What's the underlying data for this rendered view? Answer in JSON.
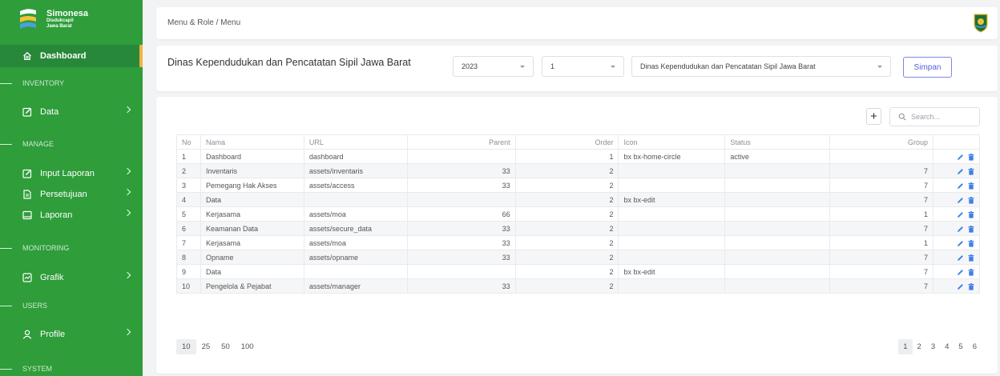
{
  "brand": {
    "title": "Simonesa",
    "subtitle1": "Disdukcapil",
    "subtitle2": "Jawa Barat"
  },
  "sidebar": {
    "items": [
      {
        "label": "Dashboard",
        "icon": "home-icon",
        "active": true
      },
      {
        "section": "INVENTORY"
      },
      {
        "label": "Data",
        "icon": "edit-icon"
      },
      {
        "section": "MANAGE"
      },
      {
        "label": "Input Laporan",
        "icon": "edit-icon"
      },
      {
        "label": "Persetujuan",
        "icon": "document-icon"
      },
      {
        "label": "Laporan",
        "icon": "card-icon"
      },
      {
        "section": "MONITORING"
      },
      {
        "label": "Grafik",
        "icon": "chart-icon"
      },
      {
        "section": "USERS"
      },
      {
        "label": "Profile",
        "icon": "user-icon"
      },
      {
        "section": "SYSTEM"
      }
    ]
  },
  "header": {
    "breadcrumb": "Menu & Role / Menu"
  },
  "filter": {
    "org_title": "Dinas Kependudukan dan Pencatatan Sipil Jawa Barat",
    "year": "2023",
    "period": "1",
    "org_select": "Dinas Kependudukan dan Pencatatan Sipil Jawa Barat",
    "save_label": "Simpan"
  },
  "table": {
    "add_label": "+",
    "search_placeholder": "Search...",
    "columns": [
      "No",
      "Nama",
      "URL",
      "Parent",
      "Order",
      "Icon",
      "Status",
      "Group"
    ],
    "rows": [
      {
        "no": "1",
        "nama": "Dashboard",
        "url": "dashboard",
        "parent": "",
        "order": "1",
        "icon": "bx bx-home-circle",
        "status": "active",
        "group": ""
      },
      {
        "no": "2",
        "nama": "Inventaris",
        "url": "assets/inventaris",
        "parent": "33",
        "order": "2",
        "icon": "",
        "status": "",
        "group": "7"
      },
      {
        "no": "3",
        "nama": "Pemegang Hak Akses",
        "url": "assets/access",
        "parent": "33",
        "order": "2",
        "icon": "",
        "status": "",
        "group": "7"
      },
      {
        "no": "4",
        "nama": "Data",
        "url": "",
        "parent": "",
        "order": "2",
        "icon": "bx bx-edit",
        "status": "",
        "group": "7"
      },
      {
        "no": "5",
        "nama": "Kerjasama",
        "url": "assets/moa",
        "parent": "66",
        "order": "2",
        "icon": "",
        "status": "",
        "group": "1"
      },
      {
        "no": "6",
        "nama": "Keamanan Data",
        "url": "assets/secure_data",
        "parent": "33",
        "order": "2",
        "icon": "",
        "status": "",
        "group": "7"
      },
      {
        "no": "7",
        "nama": "Kerjasama",
        "url": "assets/moa",
        "parent": "33",
        "order": "2",
        "icon": "",
        "status": "",
        "group": "1"
      },
      {
        "no": "8",
        "nama": "Opname",
        "url": "assets/opname",
        "parent": "33",
        "order": "2",
        "icon": "",
        "status": "",
        "group": "7"
      },
      {
        "no": "9",
        "nama": "Data",
        "url": "",
        "parent": "",
        "order": "2",
        "icon": "bx bx-edit",
        "status": "",
        "group": "7"
      },
      {
        "no": "10",
        "nama": "Pengelola & Pejabat",
        "url": "assets/manager",
        "parent": "33",
        "order": "2",
        "icon": "",
        "status": "",
        "group": "7"
      }
    ],
    "page_sizes": [
      "10",
      "25",
      "50",
      "100"
    ],
    "pages": [
      "1",
      "2",
      "3",
      "4",
      "5",
      "6"
    ]
  },
  "colors": {
    "sidebar_bg": "#2e9d3a",
    "accent": "#f3b33a",
    "edit_icon": "#3f7fe8",
    "delete_icon": "#3f7fe8",
    "save_border": "#7b86e8"
  }
}
